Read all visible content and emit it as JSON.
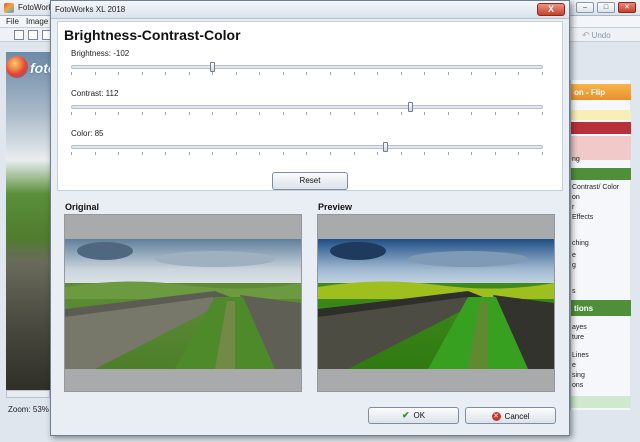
{
  "app": {
    "window_title": "FotoWorks",
    "menu": [
      "File",
      "Image"
    ],
    "undo_label": "Undo",
    "logo_text": "fotoWorks",
    "zoom_label": "Zoom: 53%",
    "panel": {
      "header_transform": "on - Flip",
      "items_group1": [
        "ng"
      ],
      "items_group2": [
        "Contrast/ Color",
        "on",
        "r",
        "Effects",
        "",
        "ching",
        "e",
        "g",
        "",
        "s"
      ],
      "header_actions": "tions",
      "items_group3": [
        "ayes",
        "ture",
        "",
        "Lines",
        "e",
        "sing",
        "ons"
      ]
    }
  },
  "dialog": {
    "title": "FotoWorks XL 2018",
    "close_label": "X",
    "heading": "Brightness-Contrast-Color",
    "sliders": [
      {
        "key": "brightness",
        "label": "Brightness: -102",
        "value": -102,
        "min": -255,
        "max": 255
      },
      {
        "key": "contrast",
        "label": "Contrast: 112",
        "value": 112,
        "min": -255,
        "max": 255
      },
      {
        "key": "color",
        "label": "Color: 85",
        "value": 85,
        "min": -255,
        "max": 255
      }
    ],
    "reset_label": "Reset",
    "original_label": "Original",
    "preview_label": "Preview",
    "ok_label": "OK",
    "cancel_label": "Cancel",
    "colors": {
      "accent_orange": "#e8912a",
      "header_red": "#b8303a",
      "header_green": "#4f8f3a",
      "ok_green": "#2f8f2a",
      "cancel_red": "#c9362c"
    }
  }
}
